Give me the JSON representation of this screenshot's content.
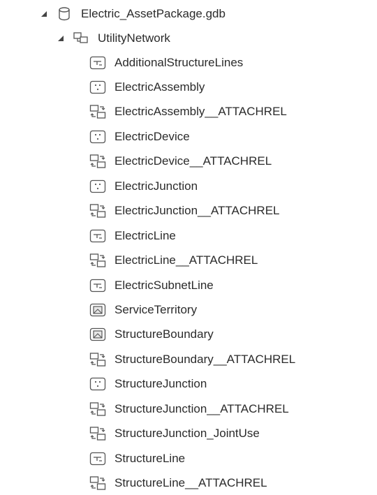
{
  "tree": {
    "root": {
      "label": "Electric_AssetPackage.gdb",
      "icon": "geodatabase-icon",
      "expanded": true
    },
    "dataset": {
      "label": "UtilityNetwork",
      "icon": "feature-dataset-icon",
      "expanded": true
    },
    "items": [
      {
        "label": "AdditionalStructureLines",
        "icon": "line-feature-class-icon"
      },
      {
        "label": "ElectricAssembly",
        "icon": "point-feature-class-icon"
      },
      {
        "label": "ElectricAssembly__ATTACHREL",
        "icon": "relationship-class-icon"
      },
      {
        "label": "ElectricDevice",
        "icon": "point-feature-class-icon"
      },
      {
        "label": "ElectricDevice__ATTACHREL",
        "icon": "relationship-class-icon"
      },
      {
        "label": "ElectricJunction",
        "icon": "point-feature-class-icon"
      },
      {
        "label": "ElectricJunction__ATTACHREL",
        "icon": "relationship-class-icon"
      },
      {
        "label": "ElectricLine",
        "icon": "line-feature-class-icon"
      },
      {
        "label": "ElectricLine__ATTACHREL",
        "icon": "relationship-class-icon"
      },
      {
        "label": "ElectricSubnetLine",
        "icon": "line-feature-class-icon"
      },
      {
        "label": "ServiceTerritory",
        "icon": "polygon-feature-class-icon"
      },
      {
        "label": "StructureBoundary",
        "icon": "polygon-feature-class-icon"
      },
      {
        "label": "StructureBoundary__ATTACHREL",
        "icon": "relationship-class-icon"
      },
      {
        "label": "StructureJunction",
        "icon": "point-feature-class-icon"
      },
      {
        "label": "StructureJunction__ATTACHREL",
        "icon": "relationship-class-icon"
      },
      {
        "label": "StructureJunction_JointUse",
        "icon": "relationship-class-icon"
      },
      {
        "label": "StructureLine",
        "icon": "line-feature-class-icon"
      },
      {
        "label": "StructureLine__ATTACHREL",
        "icon": "relationship-class-icon"
      }
    ]
  },
  "colors": {
    "text": "#2b2b2b",
    "icon_stroke": "#555555",
    "caret": "#444444"
  }
}
